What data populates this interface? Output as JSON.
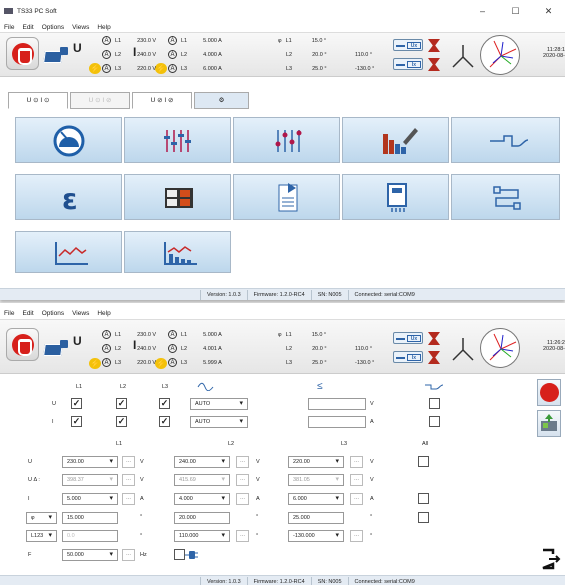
{
  "app": {
    "title": "TS33 PC Soft",
    "minimize": "–",
    "maximize": "☐",
    "close": "✕"
  },
  "menu": [
    "File",
    "Edit",
    "Options",
    "Views",
    "Help"
  ],
  "meas": {
    "u_label": "U",
    "i_label": "I",
    "rows": [
      {
        "u_phase": "L1",
        "u_val": "230.0 V",
        "i_phase": "L1",
        "i_val": "5.000 A",
        "p_phase": "L1",
        "angle": "15.0 °",
        "u_angle": ""
      },
      {
        "u_phase": "L2",
        "u_val": "240.0 V",
        "i_phase": "L2",
        "i_val": "4.000 A",
        "p_phase": "L2",
        "angle": "20.0 °",
        "u_angle": "110.0 °"
      },
      {
        "u_phase": "L3",
        "u_val": "220.0 V",
        "i_phase": "L3",
        "i_val": "6.000 A",
        "p_phase": "L3",
        "angle": "25.0 °",
        "u_angle": "-130.0 °"
      }
    ],
    "rows2": [
      {
        "u_val": "230.0 V",
        "i_val": "5.000 A",
        "angle": "15.0 °",
        "u_angle": ""
      },
      {
        "u_val": "240.0 V",
        "i_val": "4.001 A",
        "angle": "20.0 °",
        "u_angle": "110.0 °"
      },
      {
        "u_val": "220.0 V",
        "i_val": "5.999 A",
        "angle": "25.0 °",
        "u_angle": "-130.0 °"
      }
    ],
    "phi": "φ",
    "ux": "Ux",
    "ix": "Ix",
    "time1": "11:28:1",
    "date1": "2020-08-",
    "time2": "11:26:2",
    "date2": "2020-08-"
  },
  "tabs": [
    {
      "label": "U ⊙ I ⊙",
      "state": "on"
    },
    {
      "label": "U ⊙ I ⊘",
      "state": "off"
    },
    {
      "label": "U ⊘ I ⊘",
      "state": "on"
    },
    {
      "label": "⚙",
      "state": "gear"
    }
  ],
  "tiles": [
    "gauge-icon",
    "sliders-icon",
    "sliders-adjust-icon",
    "bar-chart-edit-icon",
    "step-waveform-icon",
    "epsilon-icon",
    "display-panel-icon",
    "checklist-icon",
    "memory-card-icon",
    "transfer-icon",
    "recording-chart-icon",
    "recording-bars-icon"
  ],
  "status": {
    "version": "Version: 1.0.3",
    "firmware": "Firmware: 1.2.0-RC4",
    "sn": "SN: N005",
    "connected": "Connected: serial:COM9"
  },
  "form": {
    "hdr_l1": "L1",
    "hdr_l2": "L2",
    "hdr_l3": "L3",
    "hdr_sym_le": "≤",
    "row_u": "U",
    "row_i": "I",
    "auto": "AUTO",
    "unit_v": "V",
    "unit_a": "A",
    "col_l1": "L1",
    "col_l2": "L2",
    "col_l3": "L3",
    "col_all": "All",
    "labels": [
      "U",
      "U Δ :",
      "I",
      "φ",
      "L123",
      "F"
    ],
    "l1": [
      "230.00",
      "398.37",
      "5.000",
      "15.000",
      "0.0",
      "50.000"
    ],
    "l2": [
      "240.00",
      "415.69",
      "4.000",
      "20.000",
      "110.000"
    ],
    "l3": [
      "220.00",
      "381.05",
      "6.000",
      "25.000",
      "-130.000"
    ],
    "units": [
      "V",
      "V",
      "A",
      "°",
      "°",
      "Hz"
    ],
    "dots": "...",
    "phi_sel": "φ",
    "l123_sel": "L123"
  },
  "status2": {
    "version": "Version: 1.0.3",
    "firmware": "Firmware: 1.2.0-RC4",
    "sn": "SN: N005",
    "connected": "Connected: serial:COM9"
  },
  "colors": {
    "accent": "#2e64a8",
    "stop_red": "#d7201b",
    "bolt": "#f3c10a",
    "tile_blue": "#bdd7ec"
  }
}
